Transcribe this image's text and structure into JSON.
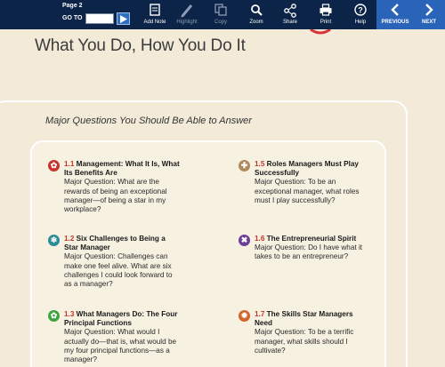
{
  "toolbar": {
    "page_label": "Page 2",
    "goto_label": "GO TO",
    "goto_value": "",
    "tools": [
      {
        "label": "Add Note",
        "icon": "add-note-icon"
      },
      {
        "label": "Highlight",
        "icon": "highlight-icon"
      },
      {
        "label": "Copy",
        "icon": "copy-icon"
      },
      {
        "label": "Zoom",
        "icon": "zoom-icon"
      },
      {
        "label": "Share",
        "icon": "share-icon"
      },
      {
        "label": "Print",
        "icon": "print-icon"
      },
      {
        "label": "Help",
        "icon": "help-icon"
      }
    ],
    "previous_label": "PREVIOUS",
    "next_label": "NEXT",
    "colors": {
      "bar": "#0b2447",
      "nav": "#2a64b8"
    }
  },
  "page": {
    "heading": "What You Do, How You Do It",
    "box_title": "Major Questions You Should Be Able to Answer",
    "items": [
      {
        "num": "1.1",
        "title": "Management: What It Is, What Its Benefits Are",
        "body": "Major Question: What are the rewards of being an exceptional manager—of being a star in my workplace?",
        "icon": "flower-badge-icon",
        "color": "#c8342c"
      },
      {
        "num": "1.2",
        "title": "Six Challenges to Being a Star Manager",
        "body": "Major Question: Challenges can make one feel alive. What are six challenges I could look forward to as a manager?",
        "icon": "snowflake-badge-icon",
        "color": "#2b8c97"
      },
      {
        "num": "1.3",
        "title": "What Managers Do: The Four Principal Functions",
        "body": "Major Question: What would I actually do—that is, what would be my four principal functions—as a manager?",
        "icon": "flower-badge-icon",
        "color": "#3fa33f"
      },
      {
        "num": "1.5",
        "title": "Roles Managers Must Play Successfully",
        "body": "Major Question: To be an exceptional manager, what roles must I play successfully?",
        "icon": "cross-badge-icon",
        "color": "#b08a5a"
      },
      {
        "num": "1.6",
        "title": "The Entrepreneurial Spirit",
        "body": "Major Question: Do I have what it takes to be an entrepreneur?",
        "icon": "star-badge-icon",
        "color": "#6c3f99"
      },
      {
        "num": "1.7",
        "title": "The Skills Star Managers Need",
        "body": "Major Question: To be a terrific manager, what skills should I cultivate?",
        "icon": "sun-badge-icon",
        "color": "#d0642a"
      }
    ]
  }
}
